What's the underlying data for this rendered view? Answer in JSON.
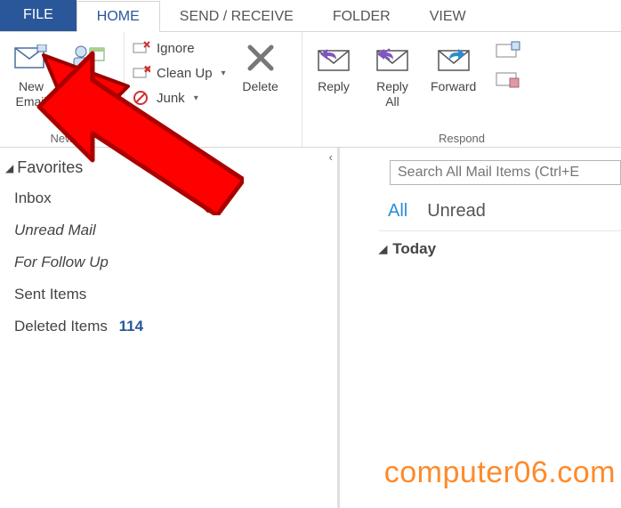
{
  "tabs": {
    "file": "FILE",
    "home": "HOME",
    "send_receive": "SEND / RECEIVE",
    "folder": "FOLDER",
    "view": "VIEW"
  },
  "ribbon": {
    "new": {
      "group_label": "New",
      "new_email": "New\nEmail",
      "new_items": "Ite"
    },
    "delete": {
      "ignore": "Ignore",
      "clean_up": "Clean Up",
      "junk": "Junk",
      "delete": "Delete"
    },
    "respond": {
      "group_label": "Respond",
      "reply": "Reply",
      "reply_all": "Reply\nAll",
      "forward": "Forward"
    }
  },
  "nav": {
    "favorites": "Favorites",
    "inbox": "Inbox",
    "unread_mail": "Unread Mail",
    "for_follow_up": "For Follow Up",
    "sent_items": "Sent Items",
    "deleted_items": "Deleted Items",
    "deleted_count": "114"
  },
  "list": {
    "search_placeholder": "Search All Mail Items (Ctrl+E",
    "filter_all": "All",
    "filter_unread": "Unread",
    "group_today": "Today"
  },
  "annotation": {
    "overlay": "arrow pointing at New Email",
    "watermark": "computer06.com"
  }
}
